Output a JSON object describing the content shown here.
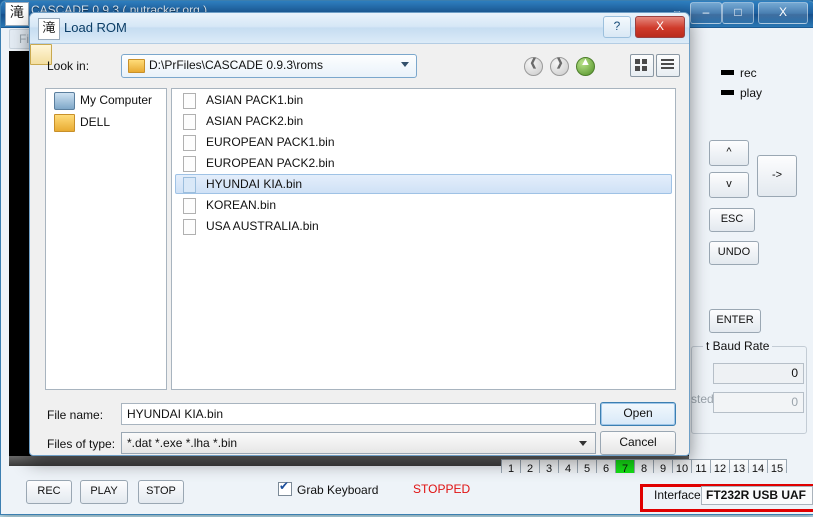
{
  "main_window": {
    "title": "CASCADE 0.9.3 ( nutracker.org )",
    "app_icon": "滝",
    "menu": {
      "file": "File"
    },
    "controls": {
      "restore_glyph": "⇔",
      "minimize": "–",
      "maximize": "□",
      "close": "X"
    },
    "right_panel": {
      "legend": [
        {
          "label": "rec"
        },
        {
          "label": "play"
        }
      ],
      "buttons": {
        "up": "^",
        "down": "v",
        "right": "->",
        "esc": "ESC",
        "undo": "UNDO",
        "enter": "ENTER"
      },
      "baud_group": {
        "legend": "t Baud Rate",
        "value_1": "0",
        "secondary_label": "sted",
        "value_2": "0"
      }
    },
    "tabs": [
      "1",
      "2",
      "3",
      "4",
      "5",
      "6",
      "7",
      "8",
      "9",
      "10",
      "11",
      "12",
      "13",
      "14",
      "15"
    ],
    "active_tab": "7",
    "bottom_bar": {
      "rec": "REC",
      "play": "PLAY",
      "stop": "STOP",
      "grab_keyboard": "Grab Keyboard",
      "grab_keyboard_checked": true,
      "status": "STOPPED",
      "status_color": "#e01111",
      "interface_label": "Interface",
      "interface_value": "FT232R USB UAF",
      "highlight_color": "#e00000"
    }
  },
  "dialog": {
    "title": "Load ROM",
    "icon": "滝",
    "help_button": "?",
    "close_button": "X",
    "look_in_label": "Look in:",
    "look_in_value": "D:\\PrFiles\\CASCADE 0.9.3\\roms",
    "toolbar": {
      "back": "←",
      "forward": "→",
      "up": "↑",
      "new_folder": "new-folder",
      "view_grid": "view-grid",
      "view_list": "view-list"
    },
    "places": [
      {
        "label": "My Computer",
        "icon": "my-computer-icon"
      },
      {
        "label": "DELL",
        "icon": "user-folder-icon"
      }
    ],
    "files": [
      {
        "name": "ASIAN PACK1.bin",
        "selected": false
      },
      {
        "name": "ASIAN PACK2.bin",
        "selected": false
      },
      {
        "name": "EUROPEAN PACK1.bin",
        "selected": false
      },
      {
        "name": "EUROPEAN PACK2.bin",
        "selected": false
      },
      {
        "name": "HYUNDAI KIA.bin",
        "selected": true
      },
      {
        "name": "KOREAN.bin",
        "selected": false
      },
      {
        "name": "USA AUSTRALIA.bin",
        "selected": false
      }
    ],
    "file_name_label": "File name:",
    "file_name_value": "HYUNDAI KIA.bin",
    "files_of_type_label": "Files of type:",
    "files_of_type_value": "*.dat *.exe *.lha *.bin",
    "open_button": "Open",
    "cancel_button": "Cancel"
  }
}
